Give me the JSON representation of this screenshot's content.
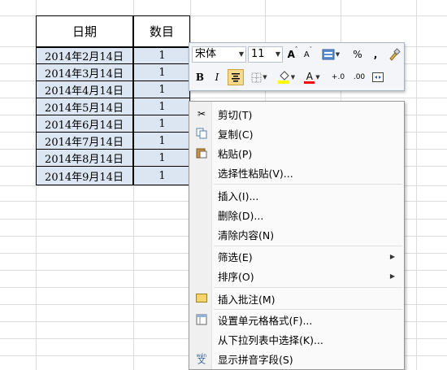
{
  "table": {
    "headers": [
      "日期",
      "数目"
    ],
    "rows": [
      [
        "2014年2月14日",
        "1"
      ],
      [
        "2014年3月14日",
        "1"
      ],
      [
        "2014年4月14日",
        "1"
      ],
      [
        "2014年5月14日",
        "1"
      ],
      [
        "2014年6月14日",
        "1"
      ],
      [
        "2014年7月14日",
        "1"
      ],
      [
        "2014年8月14日",
        "1"
      ],
      [
        "2014年9月14日",
        "1"
      ]
    ]
  },
  "mini_toolbar": {
    "font_name": "宋体",
    "font_size": "11",
    "grow_font": "A",
    "shrink_font": "A",
    "percent": "%",
    "comma": ",",
    "bold": "B",
    "italic": "I",
    "font_color": "A",
    "inc_decimal": "+.0",
    "dec_decimal": ".00"
  },
  "context_menu": {
    "items": [
      {
        "label": "剪切(T)",
        "icon": "scissors-icon"
      },
      {
        "label": "复制(C)",
        "icon": "copy-icon"
      },
      {
        "label": "粘贴(P)",
        "icon": "paste-icon"
      },
      {
        "label": "选择性粘贴(V)...",
        "icon": ""
      },
      {
        "label": "插入(I)...",
        "icon": ""
      },
      {
        "label": "删除(D)...",
        "icon": ""
      },
      {
        "label": "清除内容(N)",
        "icon": ""
      },
      {
        "label": "筛选(E)",
        "icon": "",
        "submenu": true
      },
      {
        "label": "排序(O)",
        "icon": "",
        "submenu": true
      },
      {
        "label": "插入批注(M)",
        "icon": "comment-icon"
      },
      {
        "label": "设置单元格格式(F)...",
        "icon": "format-cells-icon"
      },
      {
        "label": "从下拉列表中选择(K)...",
        "icon": ""
      },
      {
        "label": "显示拼音字段(S)",
        "icon": "phonetic-icon"
      }
    ]
  },
  "colors": {
    "selection": "#dce6f2",
    "gridline": "#dadcdd",
    "highlight": "#ffff00",
    "font_red": "#ff0000"
  }
}
